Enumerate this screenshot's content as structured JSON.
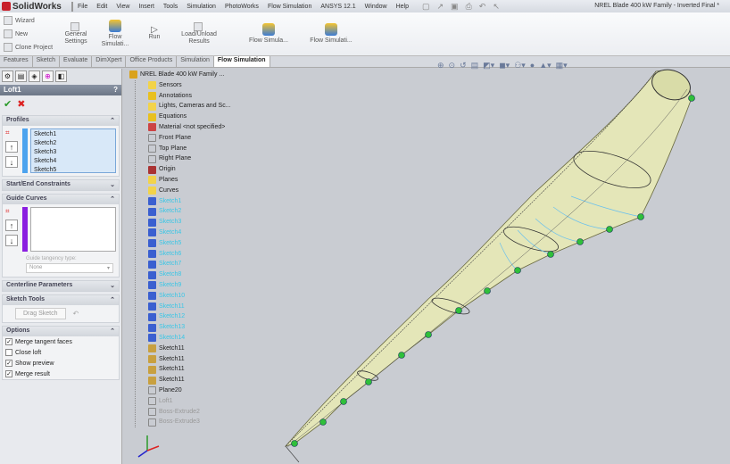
{
  "app": {
    "name": "SolidWorks",
    "doc_title": "NREL Blade 400 kW Family - Inverted Final *"
  },
  "menu": [
    "File",
    "Edit",
    "View",
    "Insert",
    "Tools",
    "Simulation",
    "PhotoWorks",
    "Flow Simulation",
    "ANSYS 12.1",
    "Window",
    "Help"
  ],
  "ribbon": {
    "wizard": "Wizard",
    "new": "New",
    "clone": "Clone Project",
    "general_settings": "General Settings",
    "flow_sim1": "Flow Simulati...",
    "run": "Run",
    "load_unload": "Load/Unload Results",
    "flow_sim2": "Flow Simula...",
    "flow_sim3": "Flow Simulati..."
  },
  "tabs": [
    "Features",
    "Sketch",
    "Evaluate",
    "DimXpert",
    "Office Products",
    "Simulation",
    "Flow Simulation"
  ],
  "panel": {
    "title": "Loft1",
    "help": "?",
    "profiles": {
      "label": "Profiles",
      "items": [
        "Sketch1",
        "Sketch2",
        "Sketch3",
        "Sketch4",
        "Sketch5"
      ]
    },
    "start_end": "Start/End Constraints",
    "guide_curves": "Guide Curves",
    "guide_tangency_label": "Guide tangency type:",
    "guide_tangency_value": "None",
    "centerline": "Centerline Parameters",
    "sketch_tools": "Sketch Tools",
    "drag_sketch": "Drag Sketch",
    "options": {
      "label": "Options",
      "items": [
        {
          "label": "Merge tangent faces",
          "checked": true
        },
        {
          "label": "Close loft",
          "checked": false
        },
        {
          "label": "Show preview",
          "checked": true
        },
        {
          "label": "Merge result",
          "checked": true
        }
      ]
    }
  },
  "tree": {
    "root": "NREL Blade 400 kW Family ...",
    "items": [
      {
        "label": "Sensors",
        "kind": "folder"
      },
      {
        "label": "Annotations",
        "kind": "annot"
      },
      {
        "label": "Lights, Cameras and Sc...",
        "kind": "folder"
      },
      {
        "label": "Equations",
        "kind": "annot"
      },
      {
        "label": "Material <not specified>",
        "kind": "material"
      },
      {
        "label": "Front Plane",
        "kind": "plane"
      },
      {
        "label": "Top Plane",
        "kind": "plane"
      },
      {
        "label": "Right Plane",
        "kind": "plane"
      },
      {
        "label": "Origin",
        "kind": "origin"
      },
      {
        "label": "Planes",
        "kind": "folder"
      },
      {
        "label": "Curves",
        "kind": "folder"
      },
      {
        "label": "Sketch1",
        "kind": "sel"
      },
      {
        "label": "Sketch2",
        "kind": "sel"
      },
      {
        "label": "Sketch3",
        "kind": "sel"
      },
      {
        "label": "Sketch4",
        "kind": "sel"
      },
      {
        "label": "Sketch5",
        "kind": "sel"
      },
      {
        "label": "Sketch6",
        "kind": "sel"
      },
      {
        "label": "Sketch7",
        "kind": "sel"
      },
      {
        "label": "Sketch8",
        "kind": "sel"
      },
      {
        "label": "Sketch9",
        "kind": "sel"
      },
      {
        "label": "Sketch10",
        "kind": "sel"
      },
      {
        "label": "Sketch11",
        "kind": "sel"
      },
      {
        "label": "Sketch12",
        "kind": "sel"
      },
      {
        "label": "Sketch13",
        "kind": "sel"
      },
      {
        "label": "Sketch14",
        "kind": "sel"
      },
      {
        "label": "Sketch11",
        "kind": "sketch"
      },
      {
        "label": "Sketch11",
        "kind": "sketch"
      },
      {
        "label": "Sketch11",
        "kind": "sketch"
      },
      {
        "label": "Sketch11",
        "kind": "sketch"
      },
      {
        "label": "Plane20",
        "kind": "plane"
      },
      {
        "label": "Loft1",
        "kind": "grey"
      },
      {
        "label": "Boss-Extrude2",
        "kind": "grey"
      },
      {
        "label": "Boss-Extrude3",
        "kind": "grey"
      }
    ]
  },
  "colors": {
    "selected": "#39c6e6",
    "blade": "#e4e6b8",
    "guide": "#8a1ee0",
    "point": "#2fbf3a"
  }
}
